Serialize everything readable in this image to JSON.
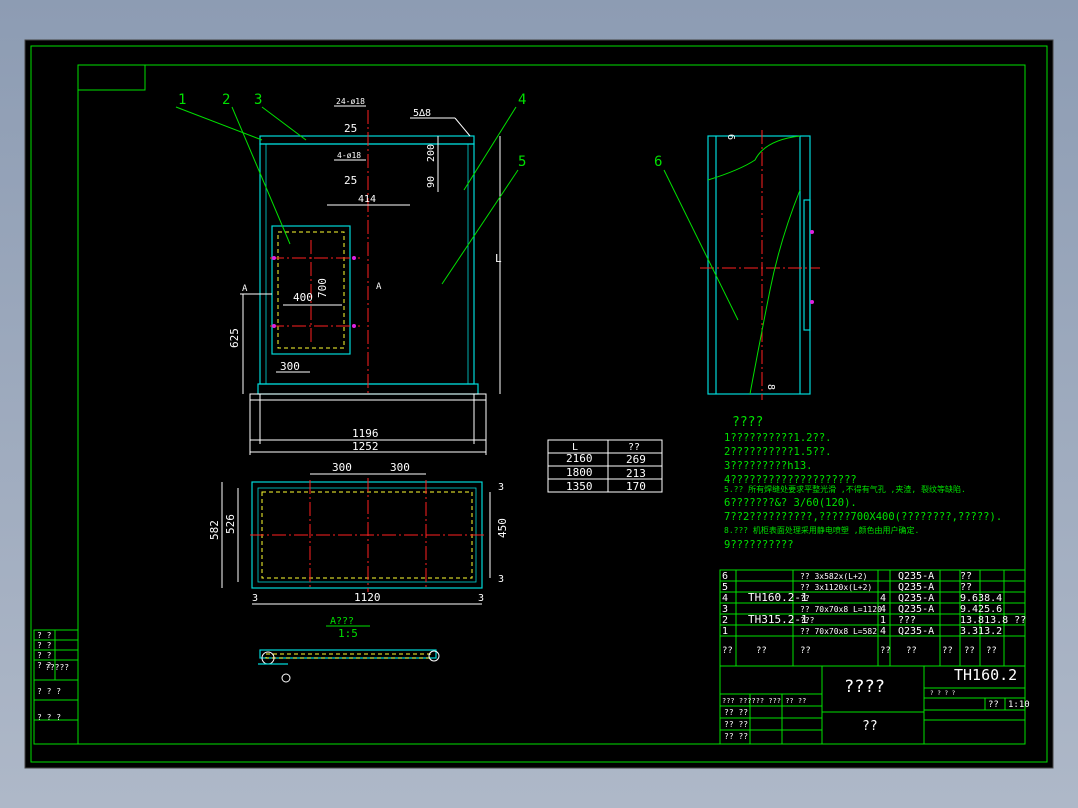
{
  "views": {
    "front": {
      "balloons": [
        "1",
        "2",
        "3",
        "4",
        "5"
      ],
      "dims": {
        "w1196": "1196",
        "w1252": "1252",
        "d400": "400",
        "d300": "300",
        "d414": "414",
        "d625": "625",
        "d700": "700",
        "d200": "200",
        "d90": "90",
        "L": "L",
        "A_left": "A",
        "A_right": "A"
      },
      "anno": {
        "hole_a": "24-ø18",
        "hole_a_pitch": "25",
        "hole_b": "4-ø18",
        "hole_b_pitch": "25",
        "top": "5∆8"
      }
    },
    "side": {
      "balloon": "6",
      "top_tag": "6",
      "bottom_tag": "8"
    },
    "plan": {
      "d300a": "300",
      "d300b": "300",
      "d582": "582",
      "d526": "526",
      "d450": "450",
      "d1120": "1120",
      "d3a": "3",
      "d3b": "3",
      "d3c": "3",
      "d3d": "3"
    },
    "section": {
      "title": "A???",
      "scale": "1:5"
    }
  },
  "length_table": {
    "headers": [
      "L",
      "??"
    ],
    "rows": [
      [
        "2160",
        "269"
      ],
      [
        "1800",
        "213"
      ],
      [
        "1350",
        "170"
      ]
    ]
  },
  "notes": {
    "title": "????",
    "lines": [
      "1??????????1.2??.",
      "2??????????1.5??.",
      "3?????????h13.",
      "4????????????????????",
      "5.?? 所有焊缝处要求平整光滑 ,不得有气孔 ,夹渣, 裂纹等缺陷.",
      "6???????&? 3/60(120).",
      "7??2??????????,?????700X400(????????,?????).",
      "8.??? 机柜表面处理采用静电喷塑 ,颜色由用户确定.",
      "9??????????"
    ]
  },
  "bom": [
    [
      "6",
      "",
      "?? 3x582x(L+2)",
      "",
      "Q235-A",
      "??"
    ],
    [
      "5",
      "",
      "?? 3x1120x(L+2)",
      "",
      "Q235-A",
      "??"
    ],
    [
      "4",
      "TH160.2-1",
      "??",
      "4",
      "Q235-A",
      "9.638.4"
    ],
    [
      "3",
      "",
      "?? 70x70x8 L=1120",
      "4",
      "Q235-A",
      "9.425.6"
    ],
    [
      "2",
      "TH315.2-1",
      "???",
      "1",
      "???",
      "13.813.8 ??"
    ],
    [
      "1",
      "",
      "?? 70x70x8 L=582",
      "4",
      "Q235-A",
      "3.313.2"
    ]
  ],
  "bom_header": [
    "??",
    "??",
    "??",
    "??",
    "??",
    "??",
    "??",
    "??"
  ],
  "title_block": {
    "drawing_no": "TH160.2",
    "name": "????",
    "unit": "??",
    "scale_label": "??",
    "scale": "1:10",
    "row1": "? ? ? ?",
    "row2": "??? ?????? ??? ?? ??",
    "row3": "?? ??",
    "row4": "?? ??",
    "row5": "?? ??"
  },
  "left_tags": {
    "a": "? ?",
    "b": "? ?",
    "c": "? ?",
    "d": "? ?",
    "e": "?????",
    "f": "? ? ?",
    "g": "? ? ?"
  }
}
